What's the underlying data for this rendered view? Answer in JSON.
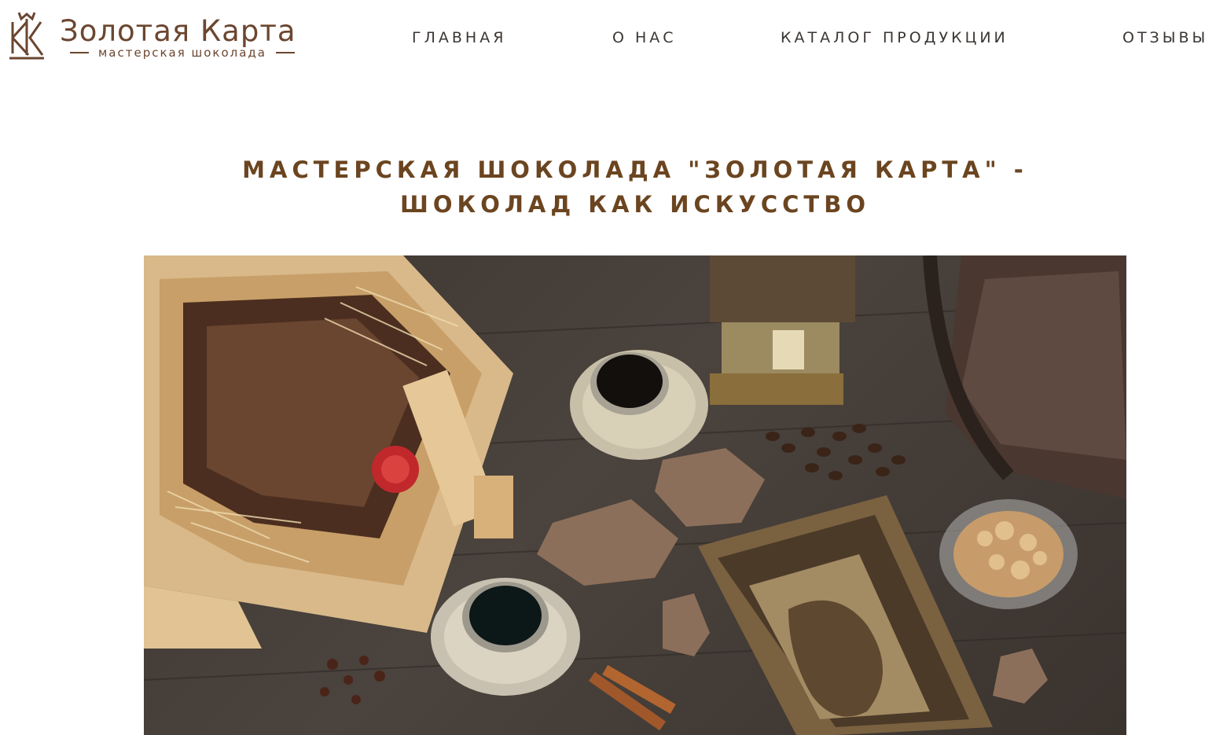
{
  "brand": {
    "title": "Золотая Карта",
    "subtitle": "мастерская шоколада"
  },
  "nav": {
    "home": "ГЛАВНАЯ",
    "about": "О НАС",
    "catalog": "КАТАЛОГ ПРОДУКЦИИ",
    "reviews": "ОТЗЫВЫ"
  },
  "main": {
    "title_line1": "МАСТЕРСКАЯ ШОКОЛАДА \"ЗОЛОТАЯ КАРТА\" -",
    "title_line2": "ШОКОЛАД КАК ИСКУССТВО"
  },
  "colors": {
    "brand_brown": "#6b4630",
    "title_brown": "#6b4520",
    "nav_text": "#3b3633"
  },
  "icons": {
    "logo_mark": "crown-monogram-icon"
  }
}
